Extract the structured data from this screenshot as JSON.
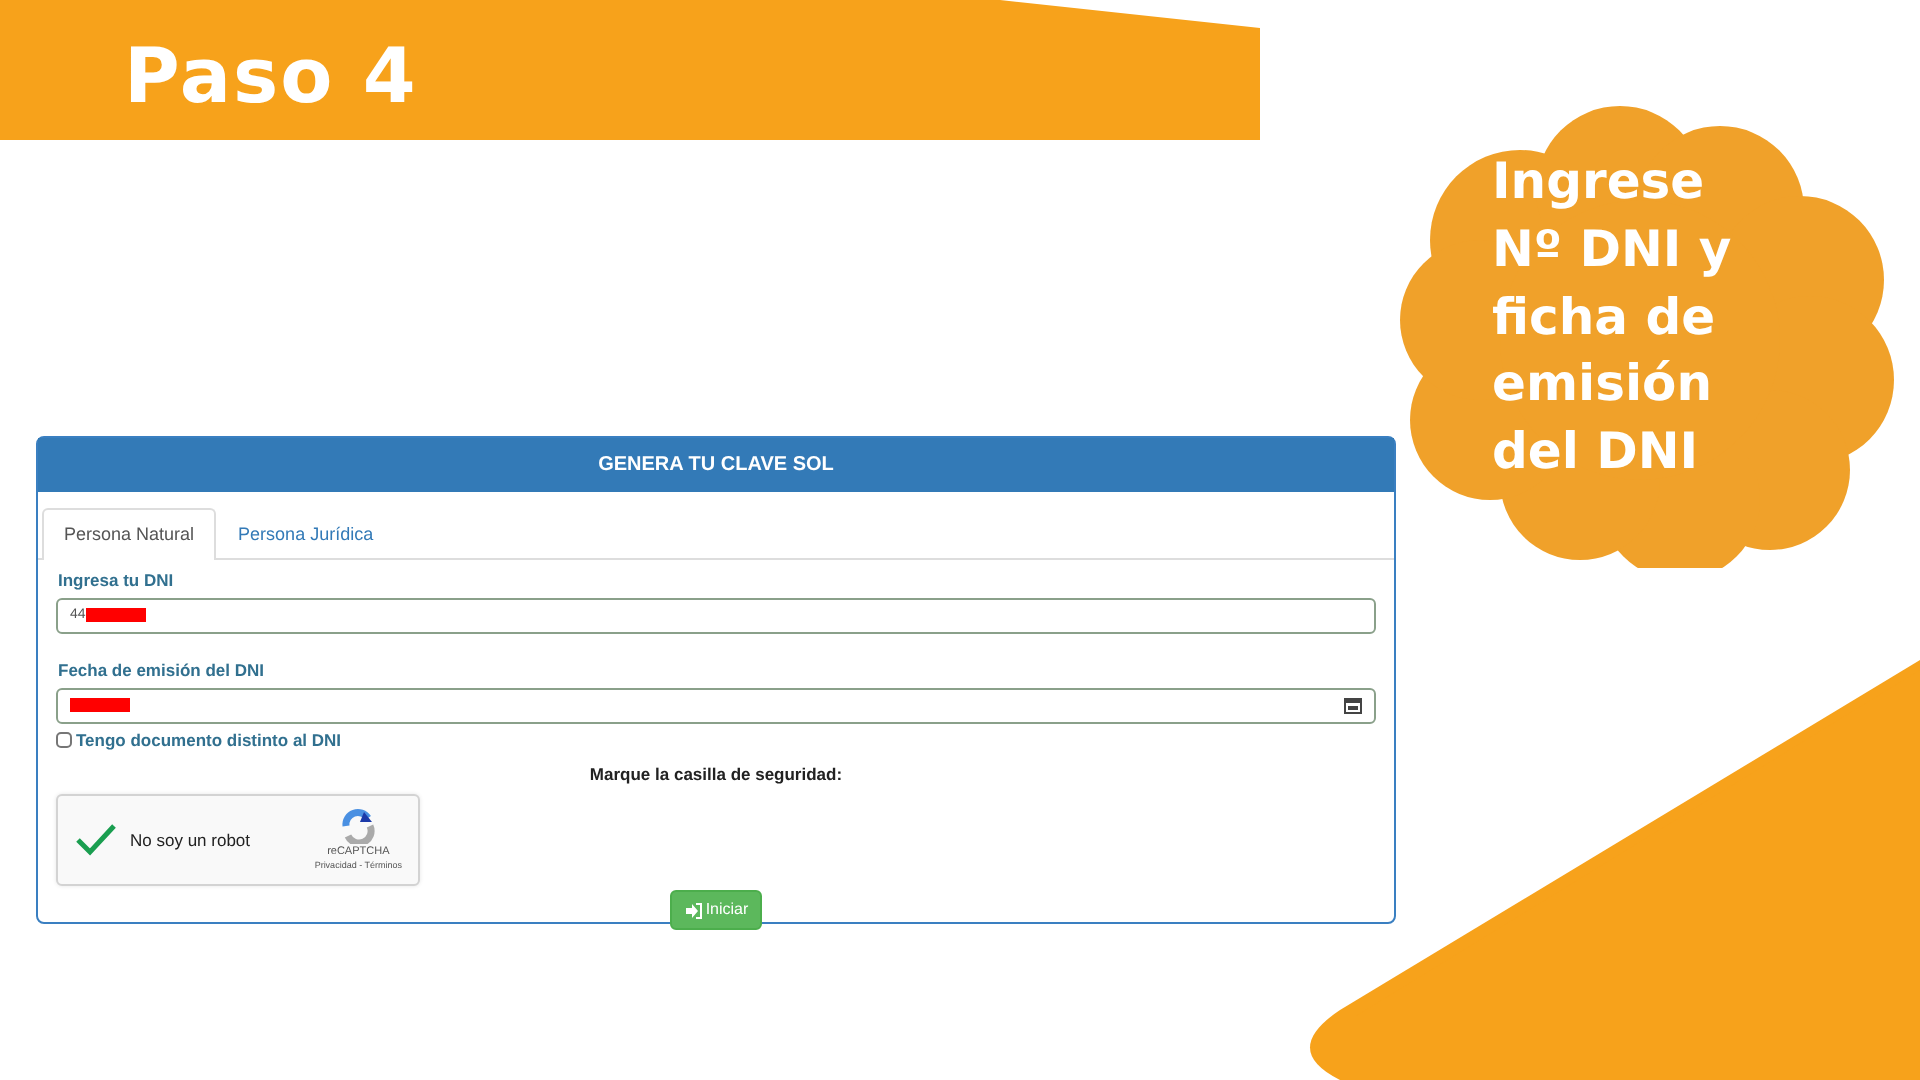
{
  "slide": {
    "title": "Paso 4",
    "callout": "Ingrese Nº DNI y ficha de emisión del DNI"
  },
  "form": {
    "header": "GENERA TU CLAVE SOL",
    "tabs": [
      {
        "label": "Persona Natural",
        "selected": true
      },
      {
        "label": "Persona Jurídica",
        "selected": false
      }
    ],
    "fields": [
      {
        "kind": "text",
        "label": "Ingresa tu DNI",
        "value": "44",
        "redacted": true
      },
      {
        "kind": "date",
        "label": "Fecha de emisión del DNI",
        "redacted": true
      }
    ],
    "checkbox": {
      "label": "Tengo documento distinto al DNI",
      "checked": false
    },
    "captcha_prompt": "Marque la casilla de seguridad:",
    "captcha": {
      "label": "No soy un robot",
      "checked": true,
      "brand": "reCAPTCHA",
      "links": "Privacidad - Términos"
    },
    "submit": "Iniciar"
  }
}
